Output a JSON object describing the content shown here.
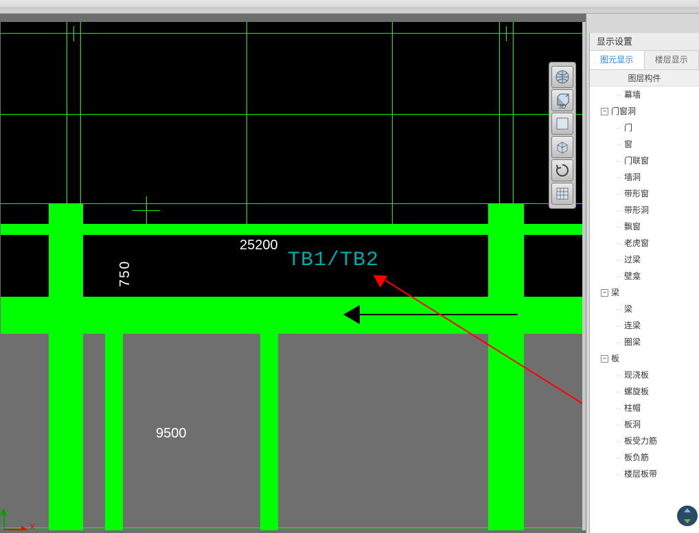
{
  "panel": {
    "title": "显示设置",
    "tab_elements": "图元显示",
    "tab_floors": "楼层显示",
    "tree_header": "图层构件",
    "items": {
      "muqiang": "幕墙",
      "menxchuangdong": "门窗洞",
      "men": "门",
      "chuang": "窗",
      "menlianchuang": "门联窗",
      "qiangdong": "墙洞",
      "daixingchuang": "带形窗",
      "daixingdong": "带形洞",
      "piaochuang": "飘窗",
      "laohuchuang": "老虎窗",
      "guoliang": "过梁",
      "bikan": "壁龛",
      "liang_group": "梁",
      "liang": "梁",
      "lianliang": "连梁",
      "quanliang": "圈梁",
      "ban_group": "板",
      "xianjiaoban": "现浇板",
      "luoxuanban": "螺旋板",
      "zhumao": "柱帽",
      "bandong": "板洞",
      "banshoulijin": "板受力筋",
      "banfujin": "板负筋",
      "loucengbandai": "楼层板带"
    }
  },
  "canvas": {
    "dim_25200": "25200",
    "dim_750": "750",
    "dim_9500": "9500",
    "entity_label": "TB1/TB2",
    "ucs_x": "X"
  },
  "viewbar": {
    "globe": "globe-icon",
    "cube3d": "3D",
    "front": "front-view",
    "iso": "iso-view",
    "rotate": "rotate",
    "grid": "grid"
  }
}
